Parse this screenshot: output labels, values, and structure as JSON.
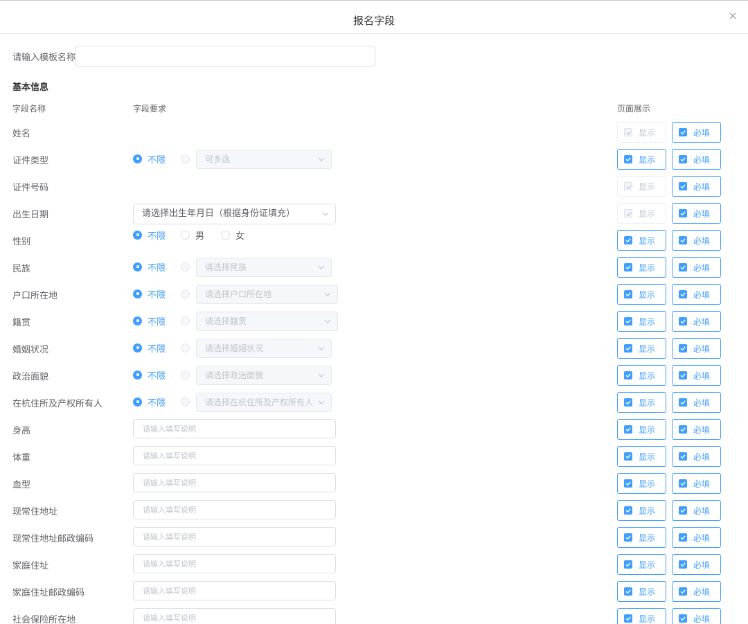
{
  "dialog": {
    "title": "报名字段"
  },
  "template": {
    "label": "请输入模板名称",
    "value": "",
    "placeholder": ""
  },
  "section": {
    "title": "基本信息"
  },
  "columns": {
    "name": "字段名称",
    "requirement": "字段要求",
    "display": "页面展示"
  },
  "checks": {
    "show": "显示",
    "required": "必填"
  },
  "radio": {
    "unlimited": "不限",
    "male": "男",
    "female": "女"
  },
  "fields": [
    {
      "label": "姓名"
    },
    {
      "label": "证件类型",
      "select": "可多选"
    },
    {
      "label": "证件号码"
    },
    {
      "label": "出生日期",
      "select": "请选择出生年月日（根据身份证填充）"
    },
    {
      "label": "性别"
    },
    {
      "label": "民族",
      "select": "请选择民族"
    },
    {
      "label": "户口所在地",
      "select": "请选择户口所在地"
    },
    {
      "label": "籍贯",
      "select": "请选择籍贯"
    },
    {
      "label": "婚姻状况",
      "select": "请选择婚姻状况"
    },
    {
      "label": "政治面貌",
      "select": "请选择政治面貌"
    },
    {
      "label": "在杭住所及产权所有人",
      "select": "请选择在杭住所及产权所有人"
    },
    {
      "label": "身高",
      "input_placeholder": "请输入填写说明"
    },
    {
      "label": "体重",
      "input_placeholder": "请输入填写说明"
    },
    {
      "label": "血型",
      "input_placeholder": "请输入填写说明"
    },
    {
      "label": "现常住地址",
      "input_placeholder": "请输入填写说明"
    },
    {
      "label": "现常住地址邮政编码",
      "input_placeholder": "请输入填写说明"
    },
    {
      "label": "家庭住址",
      "input_placeholder": "请输入填写说明"
    },
    {
      "label": "家庭住址邮政编码",
      "input_placeholder": "请输入填写说明"
    },
    {
      "label": "社会保险所在地",
      "input_placeholder": "请输入填写说明"
    }
  ],
  "colors": {
    "primary": "#409eff",
    "border": "#dcdfe6",
    "text": "#606266",
    "placeholder": "#c0c4cc"
  }
}
